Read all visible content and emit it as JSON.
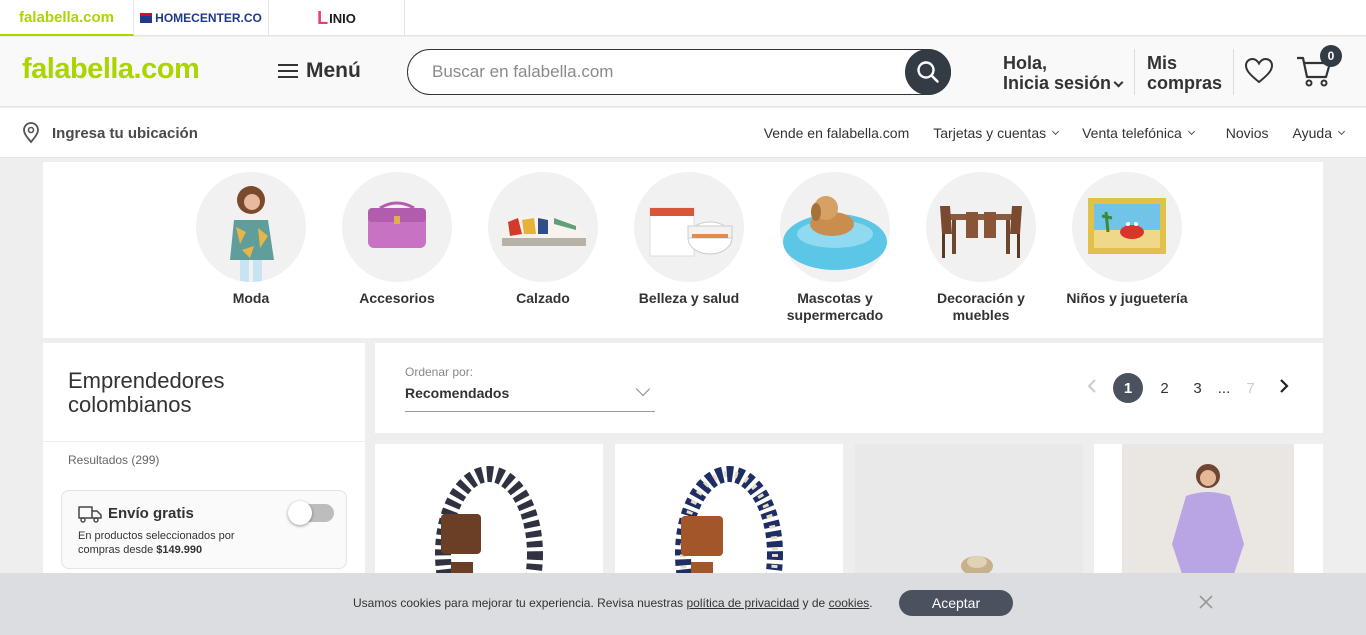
{
  "brands": [
    {
      "name": "falabella.com"
    },
    {
      "name": "HOMECENTER.CO"
    },
    {
      "name": "INIO"
    }
  ],
  "header": {
    "logo": "falabella.com",
    "menu_label": "Menú",
    "search_placeholder": "Buscar en falabella.com",
    "login_line1": "Hola,",
    "login_line2": "Inicia sesión",
    "purchases_line1": "Mis",
    "purchases_line2": "compras",
    "cart_count": "0"
  },
  "subnav": {
    "location": "Ingresa tu ubicación",
    "links": [
      {
        "label": "Vende en falabella.com",
        "dropdown": false
      },
      {
        "label": "Tarjetas y cuentas",
        "dropdown": true
      },
      {
        "label": "Venta telefónica",
        "dropdown": true
      },
      {
        "label": "Novios",
        "dropdown": false
      },
      {
        "label": "Ayuda",
        "dropdown": true
      }
    ]
  },
  "categories": [
    {
      "label": "Moda"
    },
    {
      "label": "Accesorios"
    },
    {
      "label": "Calzado"
    },
    {
      "label": "Belleza y salud"
    },
    {
      "label": "Mascotas y supermercado"
    },
    {
      "label": "Decoración y muebles"
    },
    {
      "label": "Niños y juguetería"
    }
  ],
  "sidebar": {
    "title": "Emprendedores colombianos",
    "results": "Resultados (299)",
    "shipping": {
      "title": "Envío gratis",
      "desc_prefix": "En productos seleccionados por compras desde ",
      "desc_amount": "$149.990",
      "enabled": false
    }
  },
  "sort": {
    "label": "Ordenar por:",
    "value": "Recomendados"
  },
  "pagination": {
    "pages": [
      "1",
      "2",
      "3"
    ],
    "ellipsis": "...",
    "last": "7",
    "current": "1"
  },
  "cookie": {
    "text_prefix": "Usamos cookies para mejorar tu experiencia. Revisa nuestras ",
    "privacy_link": "política de privacidad",
    "middle": " y de ",
    "cookies_link": "cookies",
    "suffix": ".",
    "accept": "Aceptar"
  },
  "colors": {
    "brand_green": "#aad500",
    "dark": "#333b45",
    "homecenter_blue": "#1e3a8a"
  }
}
